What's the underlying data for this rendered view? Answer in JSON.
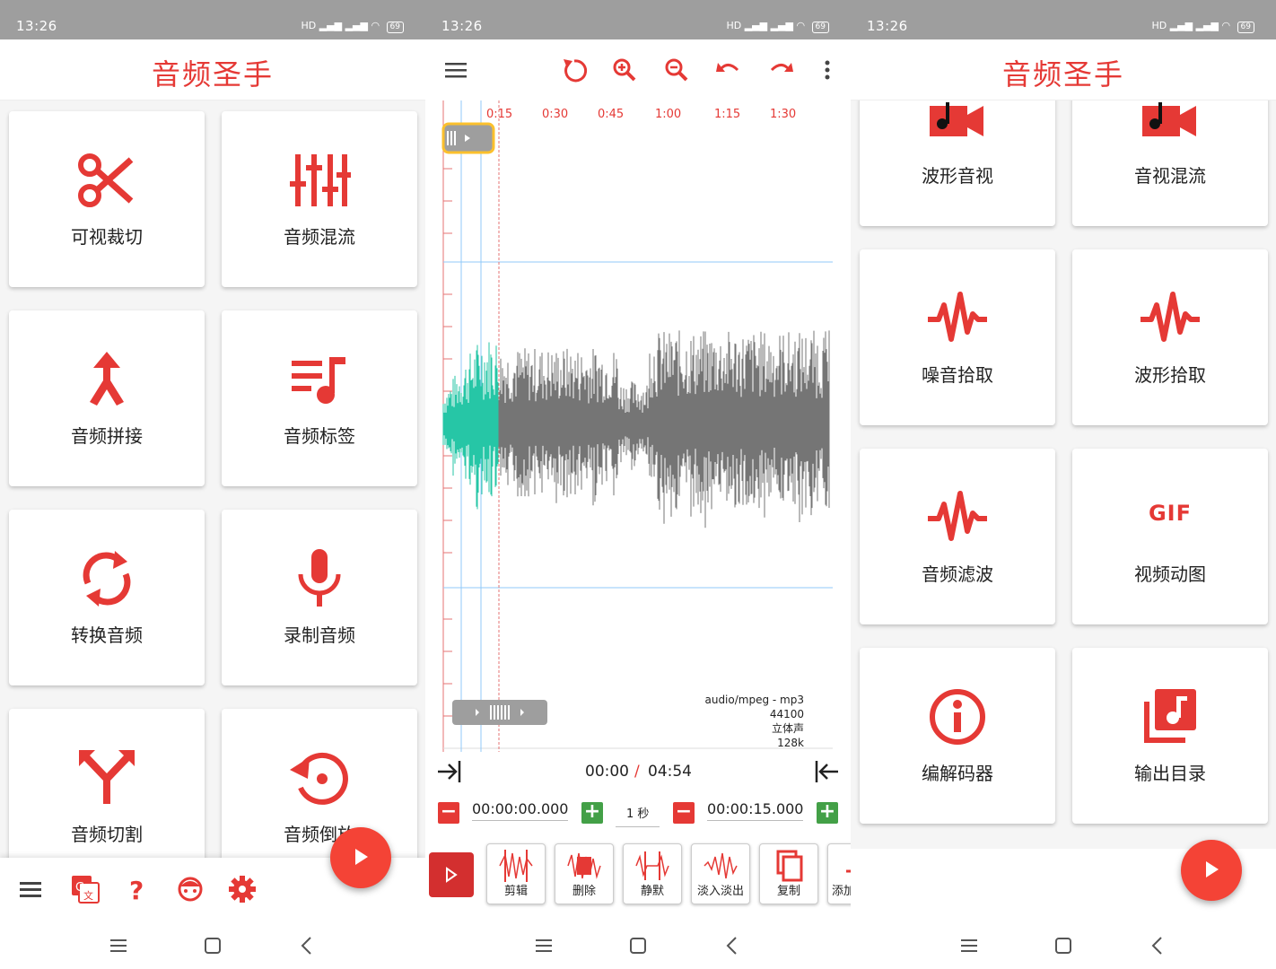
{
  "status": {
    "time": "13:26",
    "battery": "69",
    "signal": "HD"
  },
  "app": {
    "title": "音频圣手"
  },
  "screen1": {
    "cards": [
      {
        "label": "可视裁切",
        "icon": "scissors-icon"
      },
      {
        "label": "音频混流",
        "icon": "mixer-sliders-icon"
      },
      {
        "label": "音频拼接",
        "icon": "merge-arrow-icon"
      },
      {
        "label": "音频标签",
        "icon": "music-list-icon"
      },
      {
        "label": "转换音频",
        "icon": "convert-refresh-icon"
      },
      {
        "label": "录制音频",
        "icon": "microphone-icon"
      },
      {
        "label": "音频切割",
        "icon": "split-arrow-icon"
      },
      {
        "label": "音频倒放",
        "icon": "reverse-icon"
      }
    ],
    "nav": [
      "menu-icon",
      "translate-icon",
      "help-icon",
      "face-icon",
      "settings-icon"
    ]
  },
  "screen2": {
    "timeline": [
      "0:15",
      "0:30",
      "0:45",
      "1:00",
      "1:15",
      "1:30"
    ],
    "info": [
      "audio/mpeg - mp3",
      "44100",
      "立体声",
      "128k"
    ],
    "position": {
      "current": "00:00",
      "separator": "/",
      "total": "04:54"
    },
    "edit": {
      "start": "00:00:00.000",
      "step": "1 秒",
      "end": "00:00:15.000"
    },
    "actions": [
      {
        "label": "剪辑"
      },
      {
        "label": "删除"
      },
      {
        "label": "静默"
      },
      {
        "label": "淡入淡出"
      },
      {
        "label": "复制"
      },
      {
        "label": "添加"
      }
    ]
  },
  "screen3": {
    "cards": [
      {
        "label": "波形音视",
        "icon": "music-video-icon"
      },
      {
        "label": "音视混流",
        "icon": "music-video-icon"
      },
      {
        "label": "噪音拾取",
        "icon": "waveform-icon"
      },
      {
        "label": "波形拾取",
        "icon": "waveform-icon"
      },
      {
        "label": "音频滤波",
        "icon": "waveform-icon"
      },
      {
        "label": "视频动图",
        "icon": "gif-icon"
      },
      {
        "label": "编解码器",
        "icon": "info-icon"
      },
      {
        "label": "输出目录",
        "icon": "music-library-icon"
      }
    ],
    "gif_text": "GIF"
  }
}
